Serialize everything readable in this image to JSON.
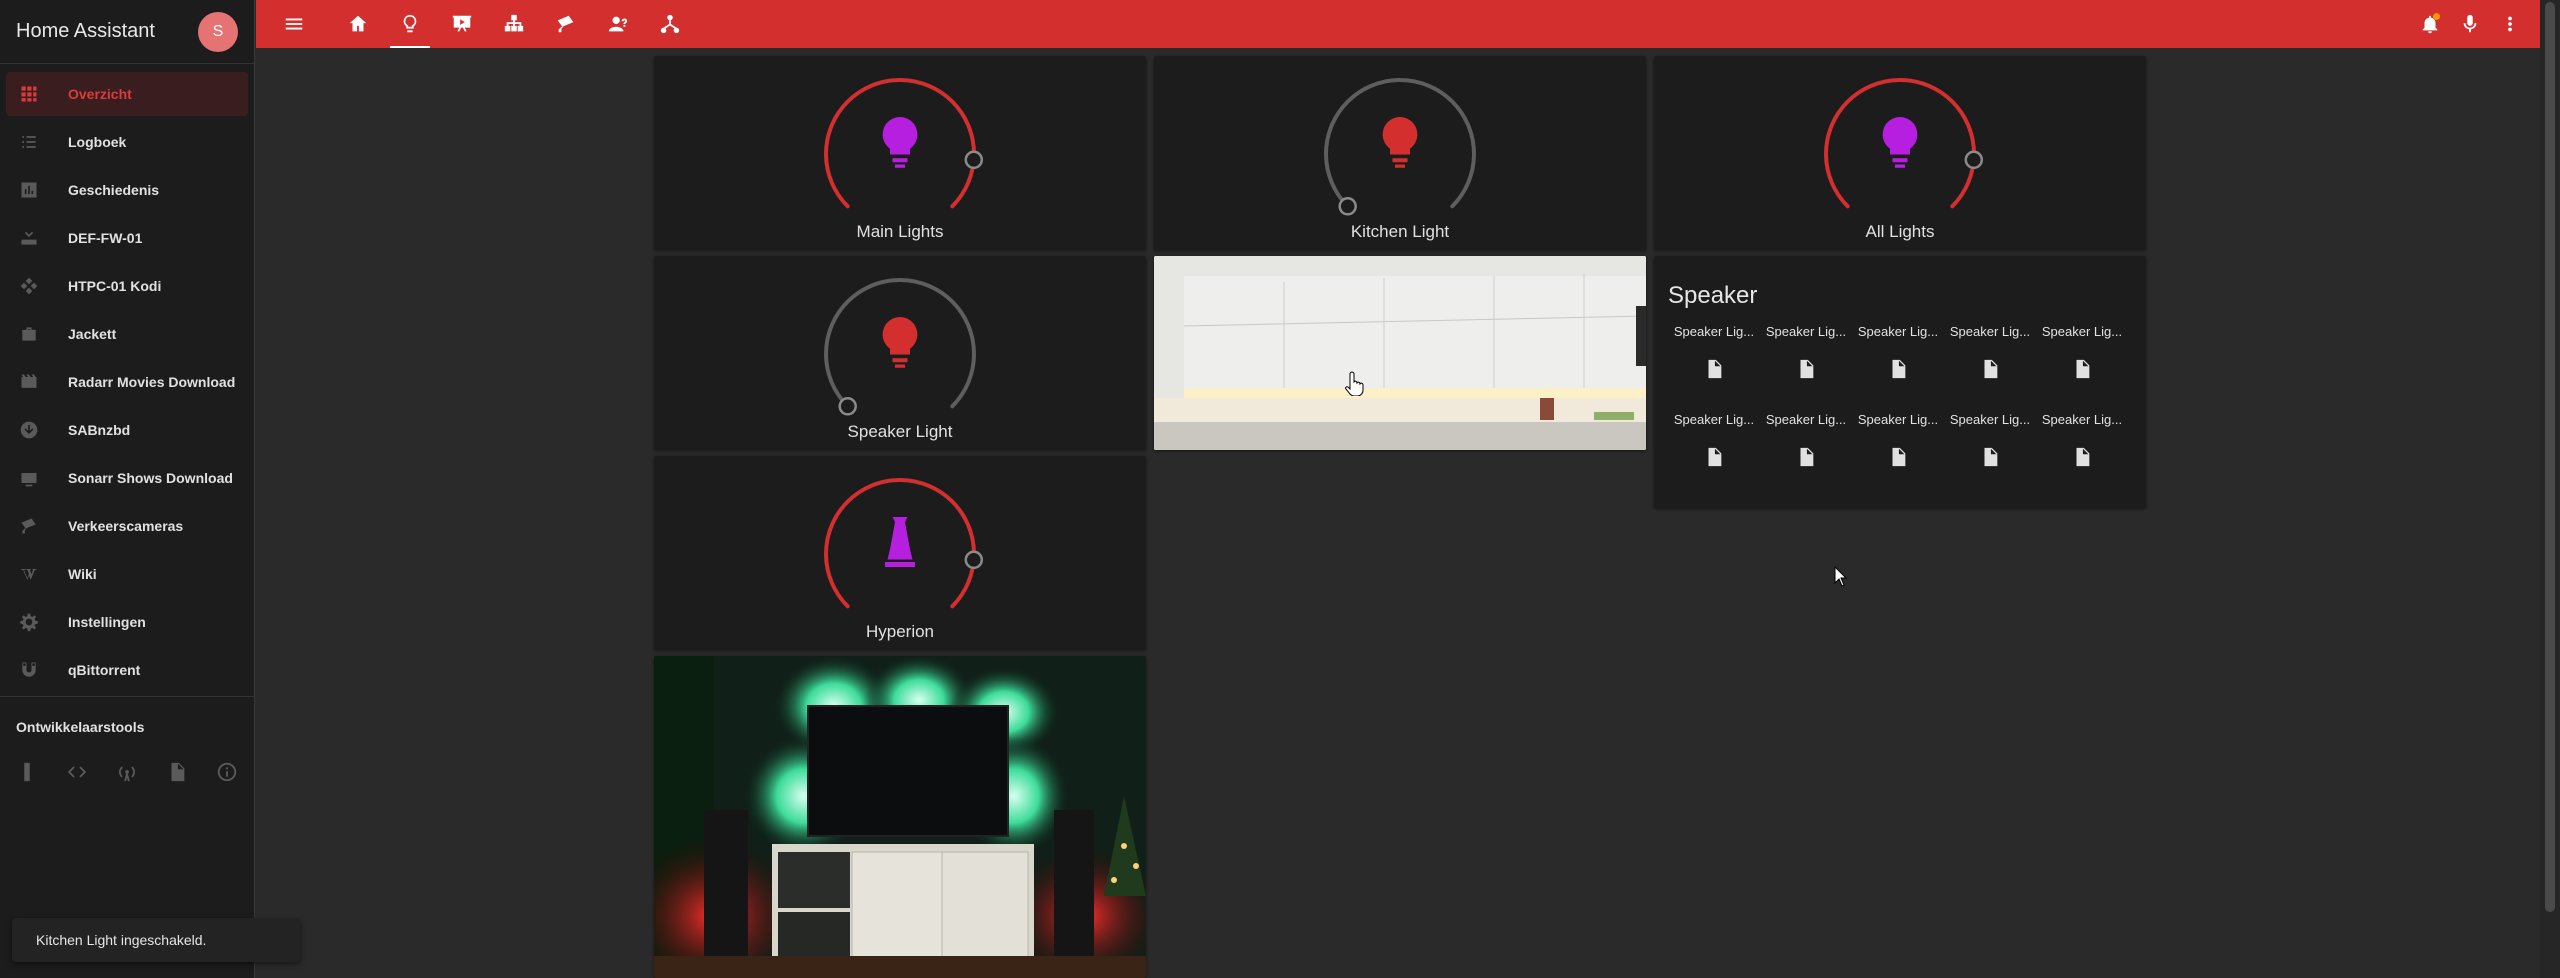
{
  "app": {
    "title": "Home Assistant",
    "user_initial": "S"
  },
  "sidebar": {
    "items": [
      {
        "label": "Overzicht",
        "icon": "view-dashboard-icon",
        "active": true
      },
      {
        "label": "Logboek",
        "icon": "format-list-bulleted-icon"
      },
      {
        "label": "Geschiedenis",
        "icon": "chart-box-icon"
      },
      {
        "label": "DEF-FW-01",
        "icon": "router-icon"
      },
      {
        "label": "HTPC-01 Kodi",
        "icon": "kodi-icon"
      },
      {
        "label": "Jackett",
        "icon": "briefcase-icon"
      },
      {
        "label": "Radarr Movies Download",
        "icon": "movie-icon"
      },
      {
        "label": "SABnzbd",
        "icon": "download-icon"
      },
      {
        "label": "Sonarr Shows Download",
        "icon": "television-icon"
      },
      {
        "label": "Verkeerscameras",
        "icon": "cctv-icon"
      },
      {
        "label": "Wiki",
        "icon": "wikipedia-icon"
      },
      {
        "label": "Instellingen",
        "icon": "cog-icon"
      },
      {
        "label": "qBittorrent",
        "icon": "magnet-icon"
      }
    ],
    "dev_tools_title": "Ontwikkelaarstools",
    "dev_tools_icons": [
      "remote-icon",
      "code-icon",
      "radio-tower-icon",
      "file-document-icon",
      "information-icon"
    ]
  },
  "toolbar": {
    "tabs": [
      "home-icon",
      "lightbulb-icon",
      "presentation-play-icon",
      "lan-icon",
      "cctv-icon",
      "account-question-icon",
      "network-icon"
    ],
    "active_tab": 1,
    "right_icons": [
      "bell-icon",
      "microphone-icon",
      "dots-vertical-icon"
    ]
  },
  "cards": {
    "main_lights": {
      "name": "Main Lights",
      "color": "#b71fe0",
      "on": true,
      "level": 0.85
    },
    "kitchen_light": {
      "name": "Kitchen Light",
      "color": "#d32f2f",
      "on": false,
      "level": 0.0
    },
    "all_lights": {
      "name": "All Lights",
      "color": "#b71fe0",
      "on": true,
      "level": 0.85
    },
    "speaker_light": {
      "name": "Speaker Light",
      "color": "#d32f2f",
      "on": false,
      "level": 0.0
    },
    "hyperion": {
      "name": "Hyperion",
      "color": "#b71fe0",
      "on": true,
      "level": 0.85
    }
  },
  "speaker_card": {
    "title": "Speaker",
    "entities": [
      "Speaker Lig...",
      "Speaker Lig...",
      "Speaker Lig...",
      "Speaker Lig...",
      "Speaker Lig...",
      "Speaker Lig...",
      "Speaker Lig...",
      "Speaker Lig...",
      "Speaker Lig...",
      "Speaker Lig..."
    ]
  },
  "toast": "Kitchen Light ingeschakeld.",
  "colors": {
    "accent": "#d32f2f",
    "background": "#2a2a2b",
    "card": "#1c1c1d",
    "ring_off": "#5e5e5e",
    "ring_on": "#d32f2f"
  }
}
